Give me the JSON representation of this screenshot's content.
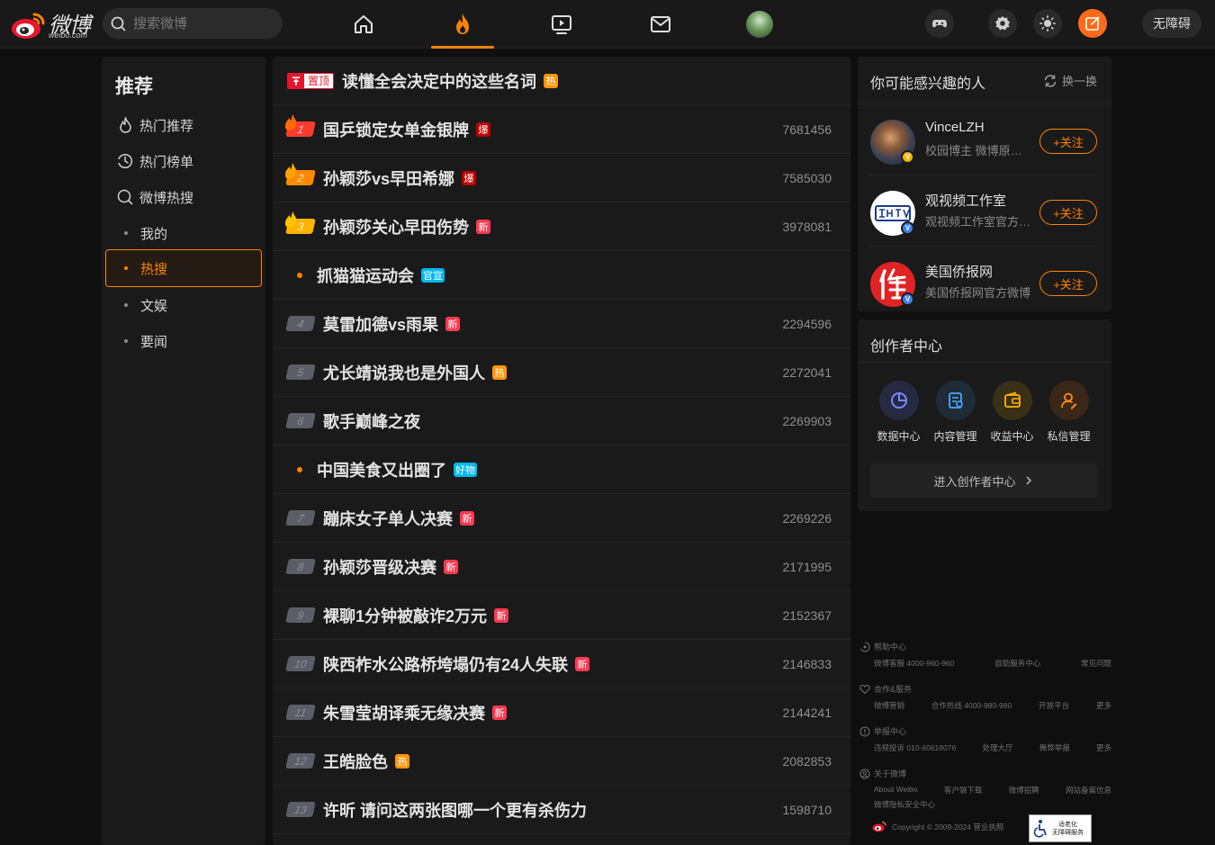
{
  "app": {
    "logo_text": "微博",
    "logo_sub": "weibo.com"
  },
  "search": {
    "placeholder": "搜索微博"
  },
  "topbar": {
    "accessibility_label": "无障碍"
  },
  "left": {
    "title": "推荐",
    "items": [
      {
        "label": "热门推荐",
        "icon": "hot-recommend-icon"
      },
      {
        "label": "热门榜单",
        "icon": "ranking-icon"
      },
      {
        "label": "微博热搜",
        "icon": "hot-search-icon"
      }
    ],
    "subs": [
      {
        "label": "我的"
      },
      {
        "label": "热搜"
      },
      {
        "label": "文娱"
      },
      {
        "label": "要闻"
      }
    ]
  },
  "hot": {
    "pinned": {
      "tag": "置顶",
      "title": "读懂全会决定中的这些名词",
      "badge": "热"
    },
    "rows": [
      {
        "rank": "1",
        "title": "国乒锁定女单金银牌",
        "badge": "爆",
        "count": "7681456"
      },
      {
        "rank": "2",
        "title": "孙颖莎vs早田希娜",
        "badge": "爆",
        "count": "7585030"
      },
      {
        "rank": "3",
        "title": "孙颖莎关心早田伤势",
        "badge": "新",
        "count": "3978081"
      },
      {
        "rank": "",
        "title": "抓猫猫运动会",
        "badge": "官宣",
        "count": ""
      },
      {
        "rank": "4",
        "title": "莫雷加德vs雨果",
        "badge": "新",
        "count": "2294596"
      },
      {
        "rank": "5",
        "title": "尤长靖说我也是外国人",
        "badge": "热",
        "count": "2272041"
      },
      {
        "rank": "6",
        "title": "歌手巅峰之夜",
        "badge": "",
        "count": "2269903"
      },
      {
        "rank": "",
        "title": "中国美食又出圈了",
        "badge": "好物",
        "count": ""
      },
      {
        "rank": "7",
        "title": "蹦床女子单人决赛",
        "badge": "新",
        "count": "2269226"
      },
      {
        "rank": "8",
        "title": "孙颖莎晋级决赛",
        "badge": "新",
        "count": "2171995"
      },
      {
        "rank": "9",
        "title": "裸聊1分钟被敲诈2万元",
        "badge": "新",
        "count": "2152367"
      },
      {
        "rank": "10",
        "title": "陕西柞水公路桥垮塌仍有24人失联",
        "badge": "新",
        "count": "2146833"
      },
      {
        "rank": "11",
        "title": "朱雪莹胡译乘无缘决赛",
        "badge": "新",
        "count": "2144241"
      },
      {
        "rank": "12",
        "title": "王皓脸色",
        "badge": "热",
        "count": "2082853"
      },
      {
        "rank": "13",
        "title": "许昕 请问这两张图哪一个更有杀伤力",
        "badge": "",
        "count": "1598710"
      }
    ]
  },
  "suggest": {
    "title": "你可能感兴趣的人",
    "refresh": "换一换",
    "follow_label": "+关注",
    "people": [
      {
        "name": "VinceLZH",
        "desc": "校园博主 微博原创视频博主",
        "badge_color": "#f5b300"
      },
      {
        "name": "观视频工作室",
        "desc": "观视频工作室官方微博",
        "badge_color": "#3d7ff3"
      },
      {
        "name": "美国侨报网",
        "desc": "美国侨报网官方微博",
        "badge_color": "#3d7ff3"
      }
    ]
  },
  "creator": {
    "title": "创作者中心",
    "tools": [
      {
        "label": "数据中心",
        "icon": "data-center-icon",
        "color": "#6f7bff"
      },
      {
        "label": "内容管理",
        "icon": "content-manage-icon",
        "color": "#4a9eff"
      },
      {
        "label": "收益中心",
        "icon": "income-center-icon",
        "color": "#ffb300"
      },
      {
        "label": "私信管理",
        "icon": "message-manage-icon",
        "color": "#ff8200"
      }
    ],
    "enter": "进入创作者中心"
  },
  "footer": {
    "help": {
      "title": "帮助中心",
      "links": [
        "微博客服 4000-960-960",
        "自助服务中心",
        "常见问题"
      ]
    },
    "coop": {
      "title": "合作&服务",
      "links": [
        "微博营销",
        "合作热线 4000-980-980",
        "开放平台",
        "更多"
      ]
    },
    "report": {
      "title": "举报中心",
      "links": [
        "违规投诉 010-60618076",
        "处理大厅",
        "舞弊举报",
        "更多"
      ]
    },
    "about": {
      "title": "关于微博",
      "links": [
        "About Weibo",
        "客户端下载",
        "微博招聘",
        "网站备案信息"
      ],
      "links2": [
        "微博隐私安全中心"
      ]
    },
    "copyright": "Copyright © 2009-2024 营业执照",
    "a11y_badge": "适老化\n无障碍服务"
  },
  "colors": {
    "accent": "#ff8200",
    "bg": "#0f0f0f",
    "panel": "#1a1a1a"
  }
}
